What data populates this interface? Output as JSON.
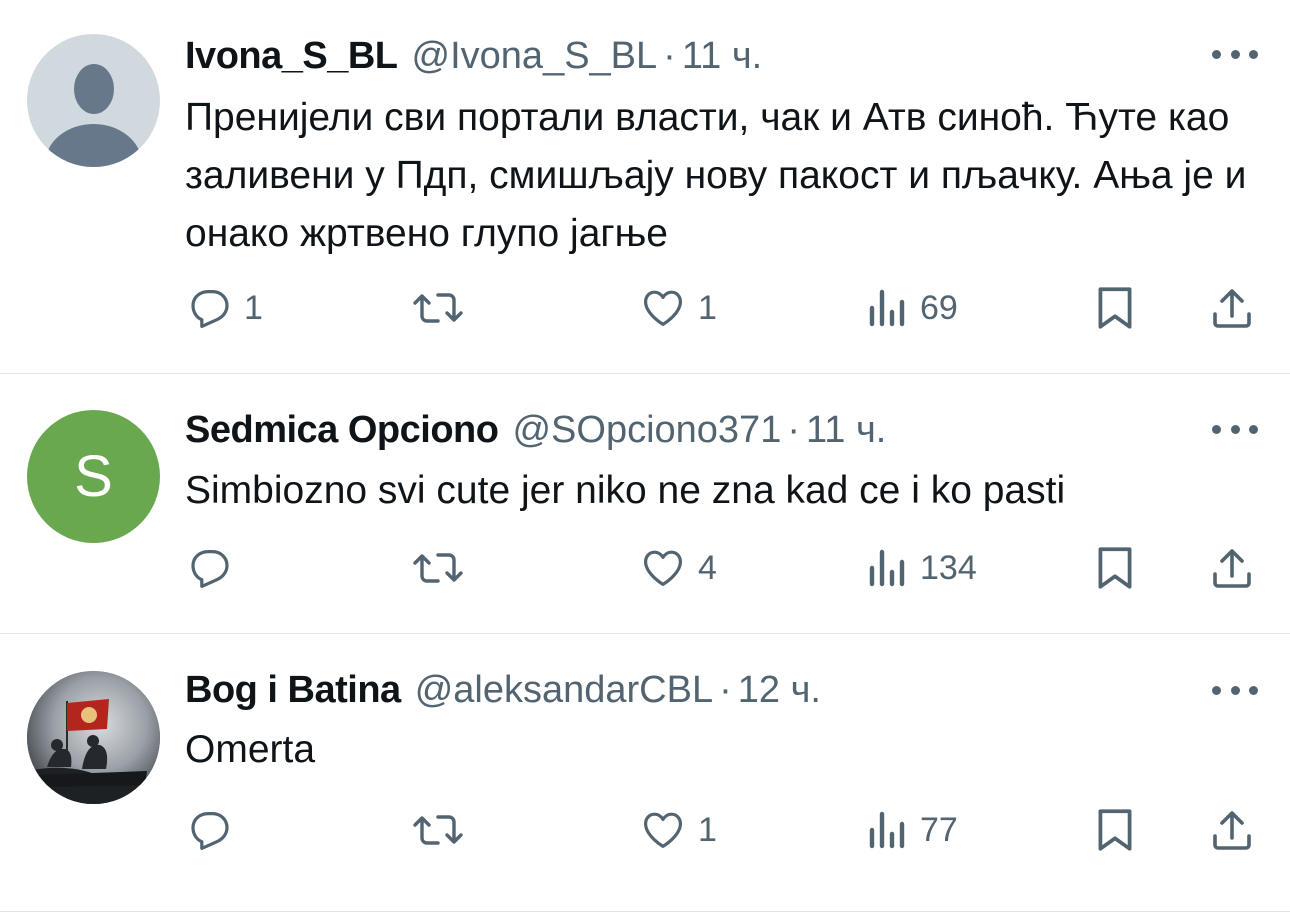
{
  "tweets": [
    {
      "name": "Ivona_S_BL",
      "handle": "@Ivona_S_BL",
      "separator": "·",
      "time": "11 ч.",
      "avatar": "default-profile-icon",
      "text": "Пренијели сви портали власти, чак и Атв синоћ. Ћуте као заливени у Пдп, смишљају нову пакост и пљачку. Ања је и онако жртвено глупо јагње",
      "replies": "1",
      "retweets": "",
      "likes": "1",
      "views": "69"
    },
    {
      "name": "Sedmica Opciono",
      "handle": "@SOpciono371",
      "separator": "·",
      "time": "11 ч.",
      "avatar_letter": "S",
      "avatar_color": "#6aa84f",
      "text": "Simbiozno svi cute jer niko ne zna kad ce i ko pasti",
      "replies": "",
      "retweets": "",
      "likes": "4",
      "views": "134"
    },
    {
      "name": "Bog i Batina",
      "handle": "@aleksandarCBL",
      "separator": "·",
      "time": "12 ч.",
      "avatar": "photo-avatar",
      "text": "Omerta",
      "replies": "",
      "retweets": "",
      "likes": "1",
      "views": "77"
    }
  ],
  "icons": {
    "reply": "reply-icon",
    "retweet": "retweet-icon",
    "like": "heart-icon",
    "views": "views-icon",
    "bookmark": "bookmark-icon",
    "share": "share-icon",
    "more": "more-icon"
  },
  "colors": {
    "text_primary": "#0f1419",
    "text_secondary": "#536471",
    "divider": "#e1e5e8"
  }
}
